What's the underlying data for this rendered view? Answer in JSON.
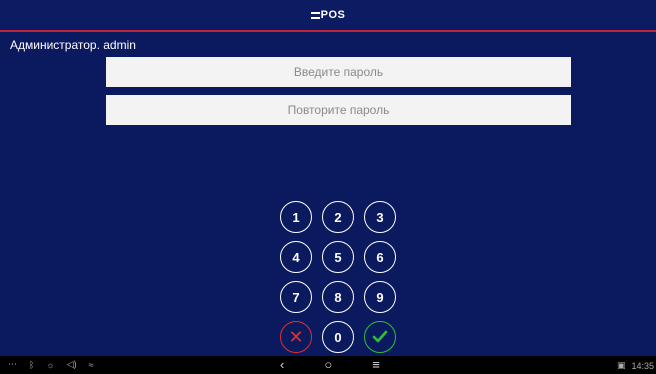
{
  "app": {
    "logo_text": "POS"
  },
  "user": {
    "label": "Администратор. admin"
  },
  "fields": {
    "password_placeholder": "Введите пароль",
    "repeat_placeholder": "Повторите пароль"
  },
  "keypad": {
    "k1": "1",
    "k2": "2",
    "k3": "3",
    "k4": "4",
    "k5": "5",
    "k6": "6",
    "k7": "7",
    "k8": "8",
    "k9": "9",
    "k0": "0",
    "cancel_symbol": "✕"
  },
  "statusbar": {
    "time": "14:35",
    "left_icons": [
      "more-icon",
      "bluetooth-icon",
      "brightness-icon",
      "volume-icon",
      "wifi-icon"
    ],
    "center_icons": [
      "back-icon",
      "home-icon",
      "menu-icon"
    ]
  },
  "colors": {
    "background": "#0b1a5e",
    "accent_line": "#c0223a",
    "cancel": "#e03030",
    "ok": "#2fbf3a"
  }
}
